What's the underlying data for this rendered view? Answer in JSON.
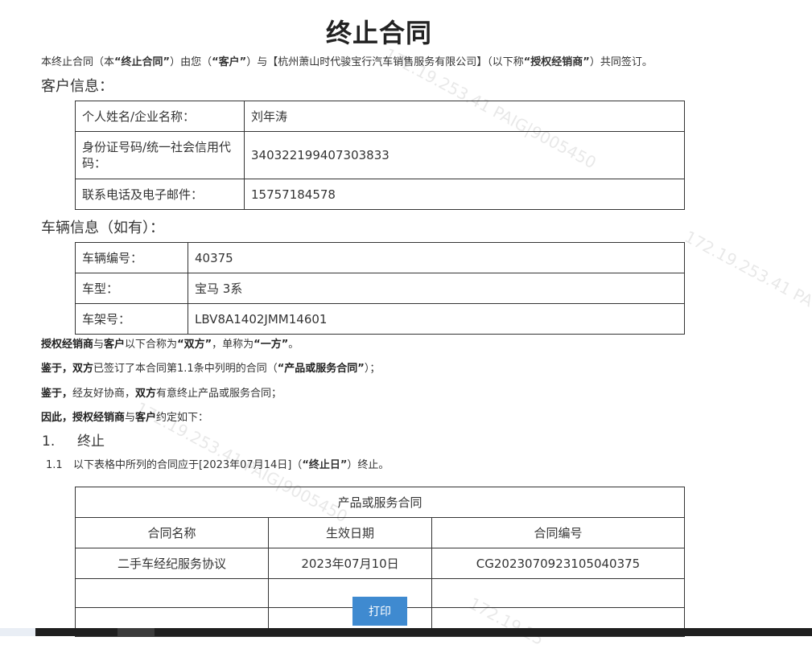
{
  "document": {
    "title": "终止合同",
    "intro": {
      "p1": "本终止合同（本",
      "b1": "“终止合同”",
      "p2": "）由您（",
      "b2": "“客户”",
      "p3": "）与【杭州萧山时代骏宝行汽车销售服务有限公司】（以下称",
      "b3": "“授权经销商”",
      "p4": "）共同签订。"
    },
    "customer_heading": "客户信息：",
    "customer": [
      {
        "label": "个人姓名/企业名称：",
        "value": "刘年涛"
      },
      {
        "label": "身份证号码/统一社会信用代码：",
        "value": "340322199407303833"
      },
      {
        "label": "联系电话及电子邮件：",
        "value": "15757184578"
      }
    ],
    "vehicle_heading": "车辆信息（如有）：",
    "vehicle": [
      {
        "label": "车辆编号：",
        "value": "40375"
      },
      {
        "label": "车型：",
        "value": "宝马 3系"
      },
      {
        "label": "车架号：",
        "value": "LBV8A1402JMM14601"
      }
    ],
    "para1": {
      "b1": "授权经销商",
      "t1": "与",
      "b2": "客户",
      "t2": "以下合称为",
      "b3": "“双方”",
      "t3": "，单称为",
      "b4": "“一方”",
      "t4": "。"
    },
    "para2": {
      "b1": "鉴于，",
      "b2": "双方",
      "t1": "已签订了本合同第1.1条中列明的合同（",
      "b3": "“产品或服务合同”",
      "t2": "）；"
    },
    "para3": {
      "b1": "鉴于，",
      "t1": "经友好协商，",
      "b2": "双方",
      "t2": "有意终止产品或服务合同；"
    },
    "para4": {
      "b1": "因此，授权经销商",
      "t1": "与",
      "b2": "客户",
      "t2": "约定如下："
    },
    "clause1": {
      "num": "1.",
      "title": "终止"
    },
    "clause1_1": {
      "num": "1.1",
      "t1": "以下表格中所列的合同应于[2023年07月14日]（",
      "b1": "“终止日”",
      "t2": "）终止。"
    },
    "contracts": {
      "caption": "产品或服务合同",
      "headers": [
        "合同名称",
        "生效日期",
        "合同编号"
      ],
      "row1": [
        "二手车经纪服务协议",
        "2023年07月10日",
        "CG20230709231050403​75"
      ]
    },
    "print_label": "打印",
    "watermarks": [
      "172.19.253.41 PAIG|9005450",
      "172.19.253.41 PA",
      "172.19.253.41 PAIG|9005450",
      "172.19.25"
    ]
  }
}
